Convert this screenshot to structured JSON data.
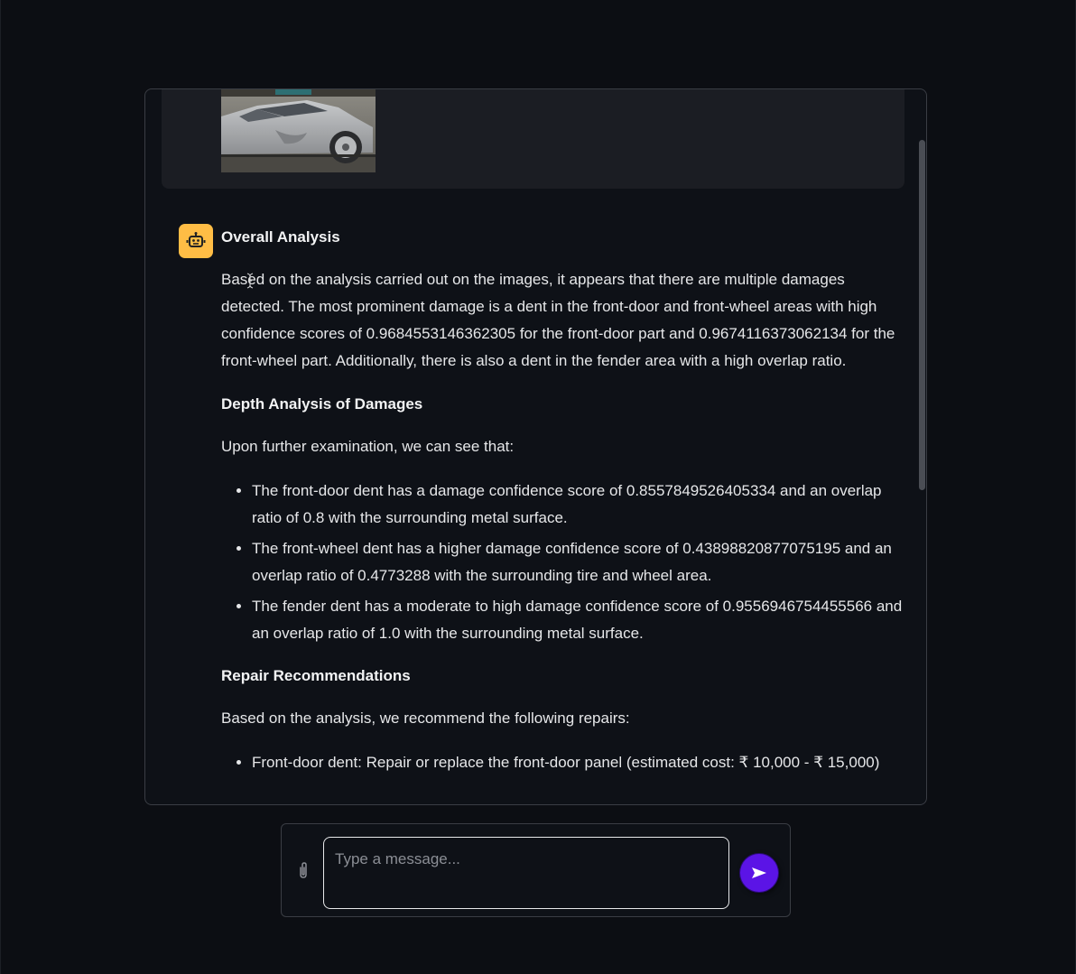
{
  "user_message": {
    "image_alt_subject": "silver car side view with dented front door"
  },
  "bot_message": {
    "avatar_icon": "robot-icon",
    "sections": {
      "overall_heading": "Overall Analysis",
      "overall_text": "Based on the analysis carried out on the images, it appears that there are multiple damages detected. The most prominent damage is a dent in the front-door and front-wheel areas with high confidence scores of 0.9684553146362305 for the front-door part and 0.9674116373062134 for the front-wheel part. Additionally, there is also a dent in the fender area with a high overlap ratio.",
      "depth_heading": "Depth Analysis of Damages",
      "depth_intro": "Upon further examination, we can see that:",
      "depth_items": [
        "The front-door dent has a damage confidence score of 0.8557849526405334 and an overlap ratio of 0.8 with the surrounding metal surface.",
        "The front-wheel dent has a higher damage confidence score of 0.43898820877075195 and an overlap ratio of 0.4773288 with the surrounding tire and wheel area.",
        "The fender dent has a moderate to high damage confidence score of 0.9556946754455566 and an overlap ratio of 1.0 with the surrounding metal surface."
      ],
      "repair_heading": "Repair Recommendations",
      "repair_intro": "Based on the analysis, we recommend the following repairs:",
      "repair_items": [
        "Front-door dent: Repair or replace the front-door panel (estimated cost: ₹ 10,000 - ₹ 15,000)"
      ]
    }
  },
  "input_bar": {
    "placeholder": "Type a message...",
    "attach_icon": "paperclip-icon",
    "send_icon": "send-arrow-icon"
  },
  "colors": {
    "background": "#0c0e13",
    "bot_avatar": "#ffbd45",
    "send_button": "#5b14e6",
    "user_bubble": "#1b1d23"
  }
}
